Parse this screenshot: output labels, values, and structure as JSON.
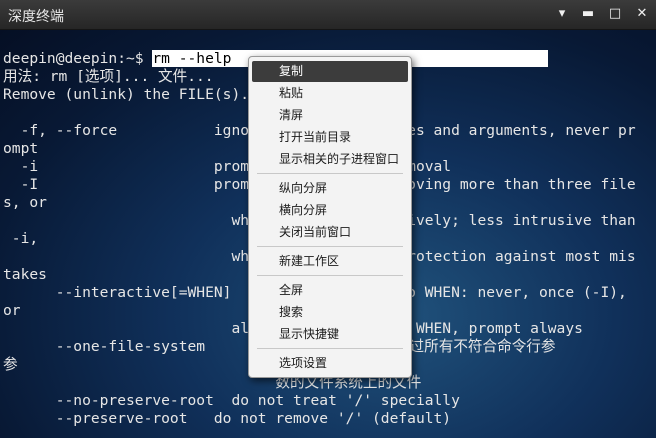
{
  "window": {
    "title": "深度终端",
    "buttons": {
      "menu": "▾",
      "minimize": "▬",
      "maximize": "□",
      "close": "✕"
    }
  },
  "terminal": {
    "prompt": "deepin@deepin:~$ ",
    "command": "rm --help                                    ",
    "lines": [
      "用法: rm [选项]... 文件...",
      "Remove (unlink) the FILE(s).",
      "",
      "  -f, --force           ignore nonexistent files and arguments, never pr",
      "ompt",
      "  -i                    prompt before every removal",
      "  -I                    prompt once before removing more than three file",
      "s, or",
      "                          when removing recursively; less intrusive than",
      " -i,",
      "                          while still giving protection against most mis",
      "takes",
      "      --interactive[=WHEN]  prompt according to WHEN: never, once (-I),",
      "or",
      "                          always (-i); without WHEN, prompt always",
      "      --one-file-system     递归删除一个层级时，跳过所有不符合命令行参",
      "参",
      "                               数的文件系统上的文件",
      "      --no-preserve-root  do not treat '/' specially",
      "      --preserve-root   do not remove '/' (default)"
    ]
  },
  "context_menu": {
    "items": [
      {
        "label": "复制",
        "active": true
      },
      {
        "label": "粘贴"
      },
      {
        "label": "清屏"
      },
      {
        "label": "打开当前目录"
      },
      {
        "label": "显示相关的子进程窗口"
      },
      {
        "label": "纵向分屏"
      },
      {
        "label": "横向分屏"
      },
      {
        "label": "关闭当前窗口"
      },
      {
        "label": "新建工作区"
      },
      {
        "label": "全屏"
      },
      {
        "label": "搜索"
      },
      {
        "label": "显示快捷键"
      },
      {
        "label": "选项设置"
      }
    ]
  }
}
